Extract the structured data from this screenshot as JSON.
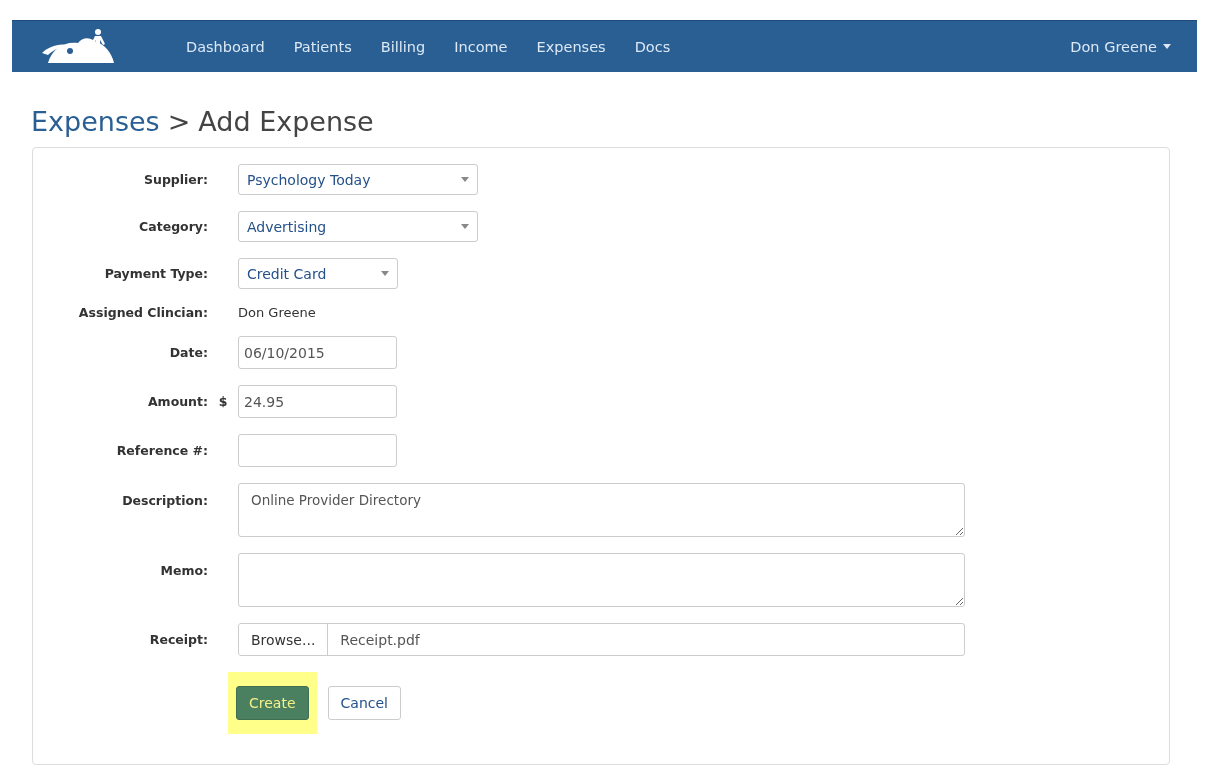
{
  "navbar": {
    "items": [
      {
        "label": "Dashboard",
        "selected": false
      },
      {
        "label": "Patients",
        "selected": false
      },
      {
        "label": "Billing",
        "selected": false
      },
      {
        "label": "Income",
        "selected": false
      },
      {
        "label": "Expenses",
        "selected": false
      },
      {
        "label": "Docs",
        "selected": false
      }
    ],
    "user": "Don Greene"
  },
  "breadcrumb": {
    "parent": "Expenses",
    "separator": ">",
    "current": "Add Expense"
  },
  "form": {
    "fields": [
      {
        "kind": "select",
        "label": "Supplier:",
        "value": "Psychology Today"
      },
      {
        "kind": "select",
        "label": "Category:",
        "value": "Advertising"
      },
      {
        "kind": "shortselect",
        "label": "Payment Type:",
        "value": "Credit Card"
      },
      {
        "kind": "static",
        "label": "Assigned Clincian:",
        "value": "Don Greene"
      },
      {
        "kind": "input",
        "label": "Date:",
        "value": "06/10/2015"
      },
      {
        "kind": "input",
        "label": "Amount:",
        "prefix": "$",
        "value": "24.95"
      },
      {
        "kind": "input",
        "label": "Reference #:"
      },
      {
        "kind": "textarea",
        "label": "Description:",
        "value": "Online Provider Directory"
      },
      {
        "kind": "textarea",
        "label": "Memo:"
      },
      {
        "kind": "file",
        "label": "Receipt:",
        "button": "Browse...",
        "value": "Receipt.pdf"
      }
    ],
    "buttons": [
      {
        "label": "Create",
        "kind": "primary",
        "highlighted": true
      },
      {
        "label": "Cancel",
        "kind": "default",
        "highlighted": false
      }
    ]
  }
}
